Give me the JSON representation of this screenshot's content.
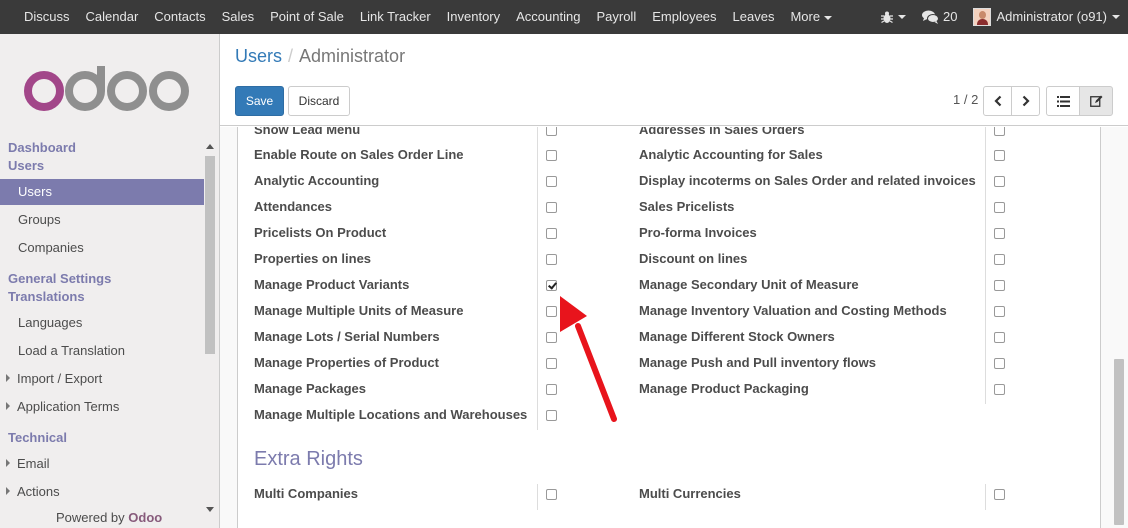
{
  "topbar": {
    "menu": [
      "Discuss",
      "Calendar",
      "Contacts",
      "Sales",
      "Point of Sale",
      "Link Tracker",
      "Inventory",
      "Accounting",
      "Payroll",
      "Employees",
      "Leaves",
      "More"
    ],
    "chat_count": "20",
    "user": "Administrator (o91)"
  },
  "sidebar": {
    "logo_text": "odoo",
    "sections": [
      {
        "title": "Dashboard"
      },
      {
        "title": "Users"
      },
      {
        "title": "General Settings"
      },
      {
        "title": "Translations"
      },
      {
        "title": "Technical"
      }
    ],
    "items": [
      "Users",
      "Groups",
      "Companies",
      "Languages",
      "Load a Translation",
      "Import / Export",
      "Application Terms",
      "Email",
      "Actions"
    ],
    "powered_by": "Powered by",
    "powered_brand": "Odoo"
  },
  "control": {
    "breadcrumb_parent": "Users",
    "breadcrumb_sep": "/",
    "breadcrumb_current": "Administrator",
    "save_label": "Save",
    "discard_label": "Discard",
    "pager": "1 / 2"
  },
  "form": {
    "left_fields": [
      {
        "label": "Show Lead Menu",
        "checked": false
      },
      {
        "label": "Enable Route on Sales Order Line",
        "checked": false
      },
      {
        "label": "Analytic Accounting",
        "checked": false
      },
      {
        "label": "Attendances",
        "checked": false
      },
      {
        "label": "Pricelists On Product",
        "checked": false
      },
      {
        "label": "Properties on lines",
        "checked": false
      },
      {
        "label": "Manage Product Variants",
        "checked": true
      },
      {
        "label": "Manage Multiple Units of Measure",
        "checked": false
      },
      {
        "label": "Manage Lots / Serial Numbers",
        "checked": false
      },
      {
        "label": "Manage Properties of Product",
        "checked": false
      },
      {
        "label": "Manage Packages",
        "checked": false
      },
      {
        "label": "Manage Multiple Locations and Warehouses",
        "checked": false
      }
    ],
    "right_fields": [
      {
        "label": "Addresses in Sales Orders",
        "checked": false
      },
      {
        "label": "Analytic Accounting for Sales",
        "checked": false
      },
      {
        "label": "Display incoterms on Sales Order and related invoices",
        "checked": false
      },
      {
        "label": "Sales Pricelists",
        "checked": false
      },
      {
        "label": "Pro-forma Invoices",
        "checked": false
      },
      {
        "label": "Discount on lines",
        "checked": false
      },
      {
        "label": "Manage Secondary Unit of Measure",
        "checked": false
      },
      {
        "label": "Manage Inventory Valuation and Costing Methods",
        "checked": false
      },
      {
        "label": "Manage Different Stock Owners",
        "checked": false
      },
      {
        "label": "Manage Push and Pull inventory flows",
        "checked": false
      },
      {
        "label": "Manage Product Packaging",
        "checked": false
      }
    ],
    "extra_rights_title": "Extra Rights",
    "extra_left": {
      "label": "Multi Companies",
      "checked": false
    },
    "extra_right": {
      "label": "Multi Currencies",
      "checked": false
    }
  },
  "colors": {
    "navbar": "#3a3a3a",
    "accent": "#7c7bad",
    "primary_button": "#337ab7",
    "annotation_arrow": "#e8141c"
  }
}
